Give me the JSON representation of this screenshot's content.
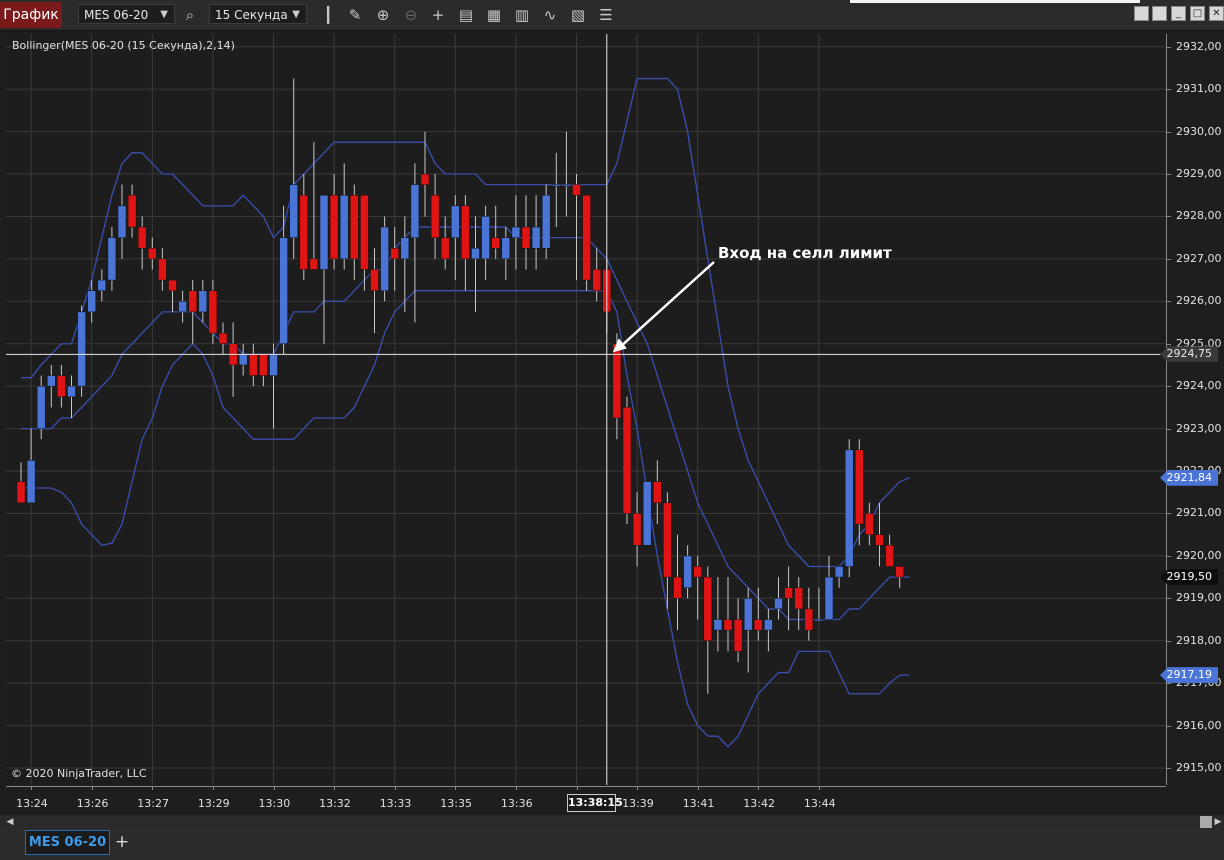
{
  "toolbar": {
    "title": "График",
    "instrument": "MES 06-20",
    "interval": "15 Секунда",
    "icons": [
      "search-icon",
      "bar-type-icon",
      "draw-tool-icon",
      "zoom-in-icon",
      "zoom-out-icon",
      "crosshair-icon",
      "data-box-icon",
      "properties-icon",
      "strategies-icon",
      "indicators-icon",
      "templates-icon",
      "chart-trader-icon"
    ]
  },
  "indicator_label": "Bollinger(MES 06-20 (15 Секунда),2,14)",
  "copyright": "© 2020 NinjaTrader, LLC",
  "annotation": "Вход на селл лимит",
  "crosshair": {
    "time_label": "13:38:15",
    "price_label": "2924,75"
  },
  "badges": [
    {
      "text": "2924,75",
      "price": 2924.75,
      "bg": "#3a3a3a",
      "fg": "#e8e8e8"
    },
    {
      "text": "2921,84",
      "price": 2921.84,
      "bg": "#4a74d6",
      "fg": "#ffffff"
    },
    {
      "text": "2919,50",
      "price": 2919.5,
      "bg": "#0e0e0e",
      "fg": "#ffffff"
    },
    {
      "text": "2917,19",
      "price": 2917.19,
      "bg": "#4a74d6",
      "fg": "#ffffff"
    }
  ],
  "tab": {
    "label": "MES 06-20",
    "add": "+"
  },
  "colors": {
    "up": "#4a74d6",
    "down": "#e01414",
    "band": "#3b4fb0",
    "grid": "#3a3a3a",
    "background": "#1d1d1d"
  },
  "chart_data": {
    "type": "candlestick",
    "title": "Bollinger(MES 06-20 (15 Секунда),2,14)",
    "ylim": [
      2914.6,
      2932.3
    ],
    "yticks": [
      2915,
      2916,
      2917,
      2918,
      2919,
      2920,
      2921,
      2922,
      2923,
      2924,
      2925,
      2926,
      2927,
      2928,
      2929,
      2930,
      2931,
      2932
    ],
    "ytick_labels": [
      "2915,00",
      "2916,00",
      "2917,00",
      "2918,00",
      "2919,00",
      "2920,00",
      "2921,00",
      "2922,00",
      "2923,00",
      "2924,00",
      "2925,00",
      "2926,00",
      "2927,00",
      "2928,00",
      "2929,00",
      "2930,00",
      "2931,00",
      "2932,00"
    ],
    "xtick_labels": [
      "13:24",
      "13:26",
      "13:27",
      "13:29",
      "13:30",
      "13:32",
      "13:33",
      "13:35",
      "13:36",
      "13:38:15",
      "13:39",
      "13:41",
      "13:42",
      "13:44"
    ],
    "xtick_bar_index": [
      1,
      7,
      13,
      19,
      25,
      31,
      37,
      43,
      49,
      55,
      61,
      67,
      73,
      79
    ],
    "grid": true,
    "candles": [
      [
        2921.75,
        2922.2,
        2921.25,
        2921.25
      ],
      [
        2921.25,
        2923.0,
        2921.25,
        2922.25
      ],
      [
        2923.0,
        2924.25,
        2922.75,
        2924.0
      ],
      [
        2924.0,
        2924.5,
        2923.5,
        2924.25
      ],
      [
        2924.25,
        2924.5,
        2923.5,
        2923.75
      ],
      [
        2923.75,
        2924.25,
        2923.25,
        2924.0
      ],
      [
        2924.0,
        2925.9,
        2923.75,
        2925.75
      ],
      [
        2925.75,
        2926.5,
        2925.5,
        2926.25
      ],
      [
        2926.25,
        2926.75,
        2926.0,
        2926.5
      ],
      [
        2926.5,
        2927.75,
        2926.25,
        2927.5
      ],
      [
        2927.5,
        2928.75,
        2927.0,
        2928.25
      ],
      [
        2928.5,
        2928.75,
        2927.5,
        2927.75
      ],
      [
        2927.75,
        2928.0,
        2926.75,
        2927.25
      ],
      [
        2927.25,
        2927.5,
        2926.75,
        2927.0
      ],
      [
        2927.0,
        2927.25,
        2926.25,
        2926.5
      ],
      [
        2926.5,
        2926.5,
        2925.75,
        2926.25
      ],
      [
        2925.75,
        2926.25,
        2925.5,
        2926.0
      ],
      [
        2926.25,
        2926.5,
        2925.0,
        2925.75
      ],
      [
        2925.75,
        2926.5,
        2925.5,
        2926.25
      ],
      [
        2926.25,
        2926.5,
        2925.0,
        2925.25
      ],
      [
        2925.25,
        2925.5,
        2924.75,
        2925.0
      ],
      [
        2925.0,
        2925.5,
        2923.75,
        2924.5
      ],
      [
        2924.5,
        2925.0,
        2924.25,
        2924.75
      ],
      [
        2924.75,
        2925.0,
        2924.0,
        2924.25
      ],
      [
        2924.75,
        2924.75,
        2924.0,
        2924.25
      ],
      [
        2924.25,
        2925.0,
        2923.0,
        2924.75
      ],
      [
        2925.0,
        2928.25,
        2924.75,
        2927.5
      ],
      [
        2927.5,
        2931.25,
        2927.0,
        2928.75
      ],
      [
        2928.5,
        2929.0,
        2926.5,
        2926.75
      ],
      [
        2927.0,
        2929.75,
        2926.75,
        2926.75
      ],
      [
        2926.75,
        2928.25,
        2925.0,
        2928.5
      ],
      [
        2928.5,
        2929.0,
        2926.75,
        2927.0
      ],
      [
        2927.0,
        2929.25,
        2926.75,
        2928.5
      ],
      [
        2928.5,
        2928.75,
        2926.5,
        2927.0
      ],
      [
        2928.5,
        2928.5,
        2926.25,
        2926.75
      ],
      [
        2926.75,
        2927.25,
        2925.25,
        2926.25
      ],
      [
        2926.25,
        2928.0,
        2926.0,
        2927.75
      ],
      [
        2927.25,
        2927.75,
        2926.25,
        2927.0
      ],
      [
        2927.0,
        2928.0,
        2925.75,
        2927.5
      ],
      [
        2927.5,
        2929.25,
        2925.5,
        2928.75
      ],
      [
        2929.0,
        2930.0,
        2928.0,
        2928.75
      ],
      [
        2928.5,
        2929.0,
        2927.0,
        2927.5
      ],
      [
        2927.5,
        2928.0,
        2926.75,
        2927.0
      ],
      [
        2927.5,
        2928.5,
        2926.5,
        2928.25
      ],
      [
        2928.25,
        2928.5,
        2926.25,
        2927.0
      ],
      [
        2927.0,
        2928.0,
        2925.75,
        2927.25
      ],
      [
        2927.0,
        2928.25,
        2926.5,
        2928.0
      ],
      [
        2927.5,
        2928.25,
        2927.0,
        2927.25
      ],
      [
        2927.0,
        2927.75,
        2926.5,
        2927.5
      ],
      [
        2927.5,
        2928.5,
        2926.75,
        2927.75
      ],
      [
        2927.75,
        2928.5,
        2926.75,
        2927.25
      ],
      [
        2927.25,
        2928.5,
        2926.75,
        2927.75
      ],
      [
        2927.25,
        2928.75,
        2927.0,
        2928.5
      ],
      [
        2928.75,
        2929.5,
        2927.75,
        2928.75
      ],
      [
        2928.75,
        2930.0,
        2928.0,
        2928.75
      ],
      [
        2928.75,
        2929.0,
        2926.5,
        2928.5
      ],
      [
        2928.5,
        2928.5,
        2926.25,
        2926.5
      ],
      [
        2926.75,
        2927.25,
        2926.0,
        2926.25
      ],
      [
        2926.75,
        2927.0,
        2925.25,
        2925.75
      ],
      [
        2925.0,
        2925.25,
        2922.75,
        2923.25
      ],
      [
        2923.5,
        2923.75,
        2920.75,
        2921.0
      ],
      [
        2921.0,
        2921.5,
        2919.75,
        2920.25
      ],
      [
        2920.25,
        2921.75,
        2920.25,
        2921.75
      ],
      [
        2921.75,
        2922.25,
        2920.75,
        2921.25
      ],
      [
        2921.25,
        2921.5,
        2918.75,
        2919.5
      ],
      [
        2919.5,
        2920.5,
        2918.25,
        2919.0
      ],
      [
        2919.25,
        2920.25,
        2919.0,
        2920.0
      ],
      [
        2919.75,
        2920.0,
        2918.5,
        2919.5
      ],
      [
        2919.5,
        2919.75,
        2916.75,
        2918.0
      ],
      [
        2918.25,
        2919.5,
        2917.75,
        2918.5
      ],
      [
        2918.5,
        2919.5,
        2917.75,
        2918.25
      ],
      [
        2918.5,
        2919.0,
        2917.5,
        2917.75
      ],
      [
        2918.25,
        2919.25,
        2917.25,
        2919.0
      ],
      [
        2918.5,
        2919.25,
        2918.0,
        2918.25
      ],
      [
        2918.25,
        2918.75,
        2917.75,
        2918.5
      ],
      [
        2918.75,
        2919.5,
        2918.5,
        2919.0
      ],
      [
        2919.25,
        2919.75,
        2918.25,
        2919.0
      ],
      [
        2919.25,
        2919.5,
        2918.25,
        2918.75
      ],
      [
        2918.75,
        2919.25,
        2918.0,
        2918.25
      ],
      [
        2918.5,
        2919.25,
        2918.5,
        2918.5
      ],
      [
        2918.5,
        2920.0,
        2918.5,
        2919.5
      ],
      [
        2919.5,
        2919.75,
        2919.25,
        2919.75
      ],
      [
        2919.75,
        2922.75,
        2919.5,
        2922.5
      ],
      [
        2922.5,
        2922.75,
        2920.25,
        2920.75
      ],
      [
        2921.0,
        2921.25,
        2920.25,
        2920.5
      ],
      [
        2920.5,
        2921.25,
        2919.75,
        2920.25
      ],
      [
        2920.25,
        2920.5,
        2919.75,
        2919.75
      ],
      [
        2919.75,
        2919.75,
        2919.25,
        2919.5
      ]
    ],
    "bands": {
      "upper": [
        2924.2,
        2924.2,
        2924.5,
        2924.75,
        2925.0,
        2925.0,
        2925.75,
        2926.5,
        2927.5,
        2928.5,
        2929.25,
        2929.5,
        2929.5,
        2929.25,
        2929.0,
        2929.0,
        2928.75,
        2928.5,
        2928.25,
        2928.25,
        2928.25,
        2928.25,
        2928.5,
        2928.25,
        2928.0,
        2927.5,
        2927.75,
        2928.75,
        2929.0,
        2929.25,
        2929.5,
        2929.75,
        2929.75,
        2929.75,
        2929.75,
        2929.75,
        2929.75,
        2929.75,
        2929.75,
        2929.75,
        2929.75,
        2929.25,
        2929.0,
        2929.0,
        2929.0,
        2929.0,
        2928.75,
        2928.75,
        2928.75,
        2928.75,
        2928.75,
        2928.75,
        2928.75,
        2928.75,
        2928.75,
        2928.75,
        2928.75,
        2928.75,
        2928.75,
        2929.25,
        2930.25,
        2931.25,
        2931.25,
        2931.25,
        2931.25,
        2931.0,
        2930.0,
        2928.5,
        2927.0,
        2925.5,
        2924.0,
        2923.0,
        2922.25,
        2921.75,
        2921.25,
        2920.75,
        2920.25,
        2920.0,
        2919.75,
        2919.75,
        2919.75,
        2919.75,
        2920.0,
        2920.5,
        2920.75,
        2921.25,
        2921.5,
        2921.75,
        2921.84
      ],
      "middle": [
        2923.0,
        2923.0,
        2923.0,
        2923.0,
        2923.25,
        2923.25,
        2923.5,
        2923.75,
        2924.0,
        2924.25,
        2924.75,
        2925.0,
        2925.25,
        2925.5,
        2925.75,
        2925.75,
        2925.75,
        2925.75,
        2925.5,
        2925.25,
        2925.0,
        2925.0,
        2924.75,
        2924.75,
        2924.75,
        2924.75,
        2925.25,
        2925.75,
        2925.75,
        2925.75,
        2926.0,
        2926.0,
        2926.0,
        2926.25,
        2926.5,
        2926.75,
        2926.75,
        2927.25,
        2927.5,
        2927.75,
        2927.75,
        2927.75,
        2927.75,
        2927.75,
        2927.75,
        2927.75,
        2927.75,
        2927.75,
        2927.75,
        2927.5,
        2927.5,
        2927.5,
        2927.5,
        2927.5,
        2927.5,
        2927.5,
        2927.5,
        2927.25,
        2927.0,
        2926.5,
        2926.0,
        2925.5,
        2925.0,
        2924.25,
        2923.5,
        2922.75,
        2922.0,
        2921.25,
        2920.75,
        2920.25,
        2919.75,
        2919.5,
        2919.25,
        2919.0,
        2918.75,
        2918.75,
        2918.5,
        2918.5,
        2918.5,
        2918.5,
        2918.5,
        2918.5,
        2918.75,
        2918.75,
        2919.0,
        2919.25,
        2919.5,
        2919.5,
        2919.5
      ],
      "lower": [
        2921.6,
        2921.6,
        2921.6,
        2921.6,
        2921.5,
        2921.25,
        2920.75,
        2920.5,
        2920.25,
        2920.3,
        2920.75,
        2921.75,
        2922.75,
        2923.25,
        2924.0,
        2924.5,
        2924.75,
        2925.0,
        2924.75,
        2924.25,
        2923.5,
        2923.25,
        2923.0,
        2922.75,
        2922.75,
        2922.75,
        2922.75,
        2922.75,
        2923.0,
        2923.25,
        2923.25,
        2923.25,
        2923.25,
        2923.5,
        2924.0,
        2924.5,
        2925.25,
        2925.75,
        2926.0,
        2926.25,
        2926.25,
        2926.25,
        2926.25,
        2926.25,
        2926.25,
        2926.25,
        2926.25,
        2926.25,
        2926.25,
        2926.25,
        2926.25,
        2926.25,
        2926.25,
        2926.25,
        2926.25,
        2926.25,
        2926.25,
        2926.25,
        2926.25,
        2925.75,
        2924.25,
        2923.0,
        2921.5,
        2920.0,
        2918.75,
        2917.5,
        2916.5,
        2916.0,
        2915.75,
        2915.75,
        2915.5,
        2915.75,
        2916.25,
        2916.75,
        2917.0,
        2917.25,
        2917.25,
        2917.75,
        2917.75,
        2917.75,
        2917.75,
        2917.25,
        2916.75,
        2916.75,
        2916.75,
        2916.75,
        2917.0,
        2917.19,
        2917.19
      ]
    },
    "crosshair_price": 2924.75,
    "crosshair_bar_index": 58
  }
}
